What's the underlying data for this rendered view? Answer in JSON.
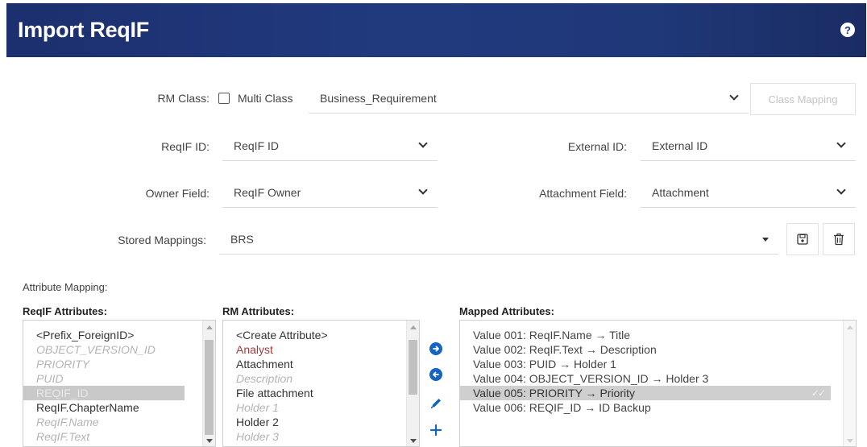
{
  "header": {
    "title": "Import ReqIF",
    "help_glyph": "?"
  },
  "form": {
    "rm_class": {
      "label": "RM Class:",
      "multi_class_label": "Multi Class",
      "multi_class_checked": false,
      "value": "Business_Requirement",
      "class_mapping_button": "Class Mapping"
    },
    "reqif_id": {
      "label": "ReqIF ID:",
      "value": "ReqIF ID"
    },
    "external_id": {
      "label": "External ID:",
      "value": "External ID"
    },
    "owner_field": {
      "label": "Owner Field:",
      "value": "ReqIF Owner"
    },
    "attachment_field": {
      "label": "Attachment Field:",
      "value": "Attachment"
    },
    "stored_mappings": {
      "label": "Stored Mappings:",
      "value": "BRS"
    }
  },
  "attribute_mapping": {
    "label": "Attribute Mapping:",
    "reqif_header": "ReqIF Attributes:",
    "rm_header": "RM Attributes:",
    "mapped_header": "Mapped Attributes:",
    "reqif_attributes": [
      {
        "text": "<Prefix_ForeignID>",
        "state": "normal"
      },
      {
        "text": "OBJECT_VERSION_ID",
        "state": "muted"
      },
      {
        "text": "PRIORITY",
        "state": "muted"
      },
      {
        "text": "PUID",
        "state": "muted"
      },
      {
        "text": "REQIF_ID",
        "state": "sel"
      },
      {
        "text": "ReqIF.ChapterName",
        "state": "normal"
      },
      {
        "text": "ReqIF.Name",
        "state": "muted"
      },
      {
        "text": "ReqIF.Text",
        "state": "muted"
      }
    ],
    "rm_attributes": [
      {
        "text": "<Create Attribute>",
        "state": "normal"
      },
      {
        "text": "Analyst",
        "state": "red"
      },
      {
        "text": "Attachment",
        "state": "normal"
      },
      {
        "text": "Description",
        "state": "muted"
      },
      {
        "text": "File attachment",
        "state": "normal"
      },
      {
        "text": "Holder 1",
        "state": "muted"
      },
      {
        "text": "Holder 2",
        "state": "normal"
      },
      {
        "text": "Holder 3",
        "state": "muted"
      }
    ],
    "mapped_attributes": [
      {
        "text": "Value 001: ReqIF.Name → Title",
        "selected": false
      },
      {
        "text": "Value 002: ReqIF.Text → Description",
        "selected": false
      },
      {
        "text": "Value 003: PUID → Holder 1",
        "selected": false
      },
      {
        "text": "Value 004: OBJECT_VERSION_ID → Holder 3",
        "selected": false
      },
      {
        "text": "Value 005: PRIORITY → Priority",
        "selected": true
      },
      {
        "text": "Value 006: REQIF_ID → ID Backup",
        "selected": false
      }
    ],
    "controls": [
      "arrow-right-icon",
      "arrow-left-icon",
      "pencil-icon",
      "plus-icon"
    ],
    "accent_color": "#1565c0"
  },
  "colors": {
    "header_start": "#1c2f6e",
    "header_end": "#1a2c62",
    "selection": "#c9c9c9"
  }
}
